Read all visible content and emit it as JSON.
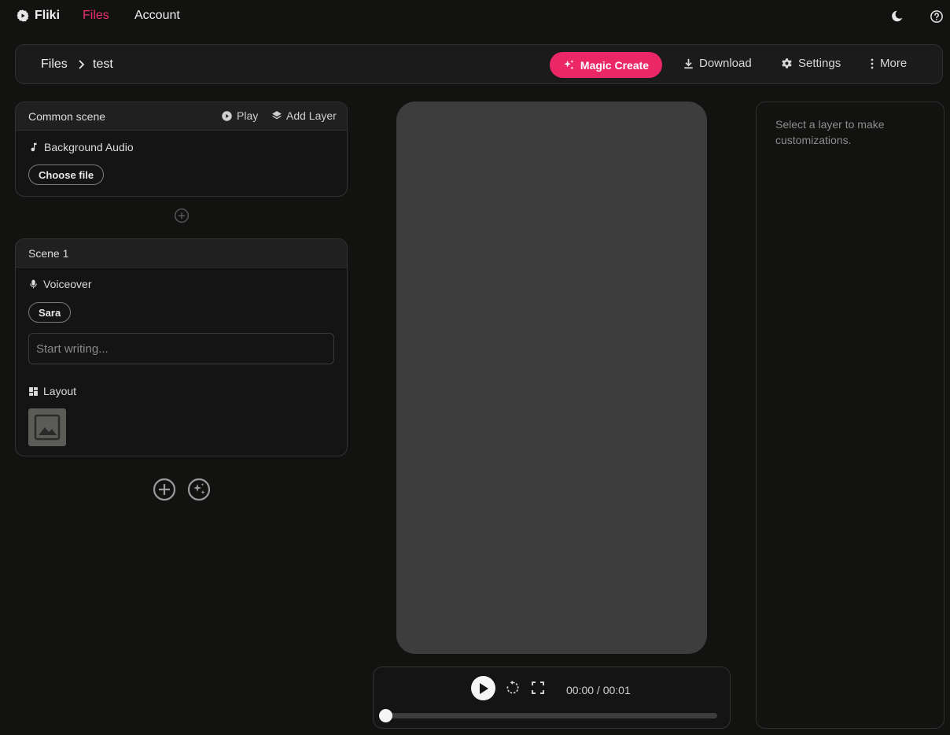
{
  "nav": {
    "brand": "Fliki",
    "files": "Files",
    "account": "Account"
  },
  "toolbar": {
    "breadcrumb": [
      "Files",
      "test"
    ],
    "magic_create": "Magic Create",
    "download": "Download",
    "settings": "Settings",
    "more": "More"
  },
  "common_scene": {
    "title": "Common scene",
    "play": "Play",
    "add_layer": "Add Layer",
    "background_audio": "Background Audio",
    "choose_file": "Choose file"
  },
  "scene1": {
    "title": "Scene 1",
    "voiceover": "Voiceover",
    "voice": "Sara",
    "placeholder": "Start writing...",
    "layout": "Layout"
  },
  "player": {
    "time": "00:00 / 00:01",
    "progress": 0
  },
  "right_panel": {
    "hint": "Select a layer to make customizations."
  },
  "colors": {
    "accent": "#eb2767",
    "background": "#121211"
  }
}
